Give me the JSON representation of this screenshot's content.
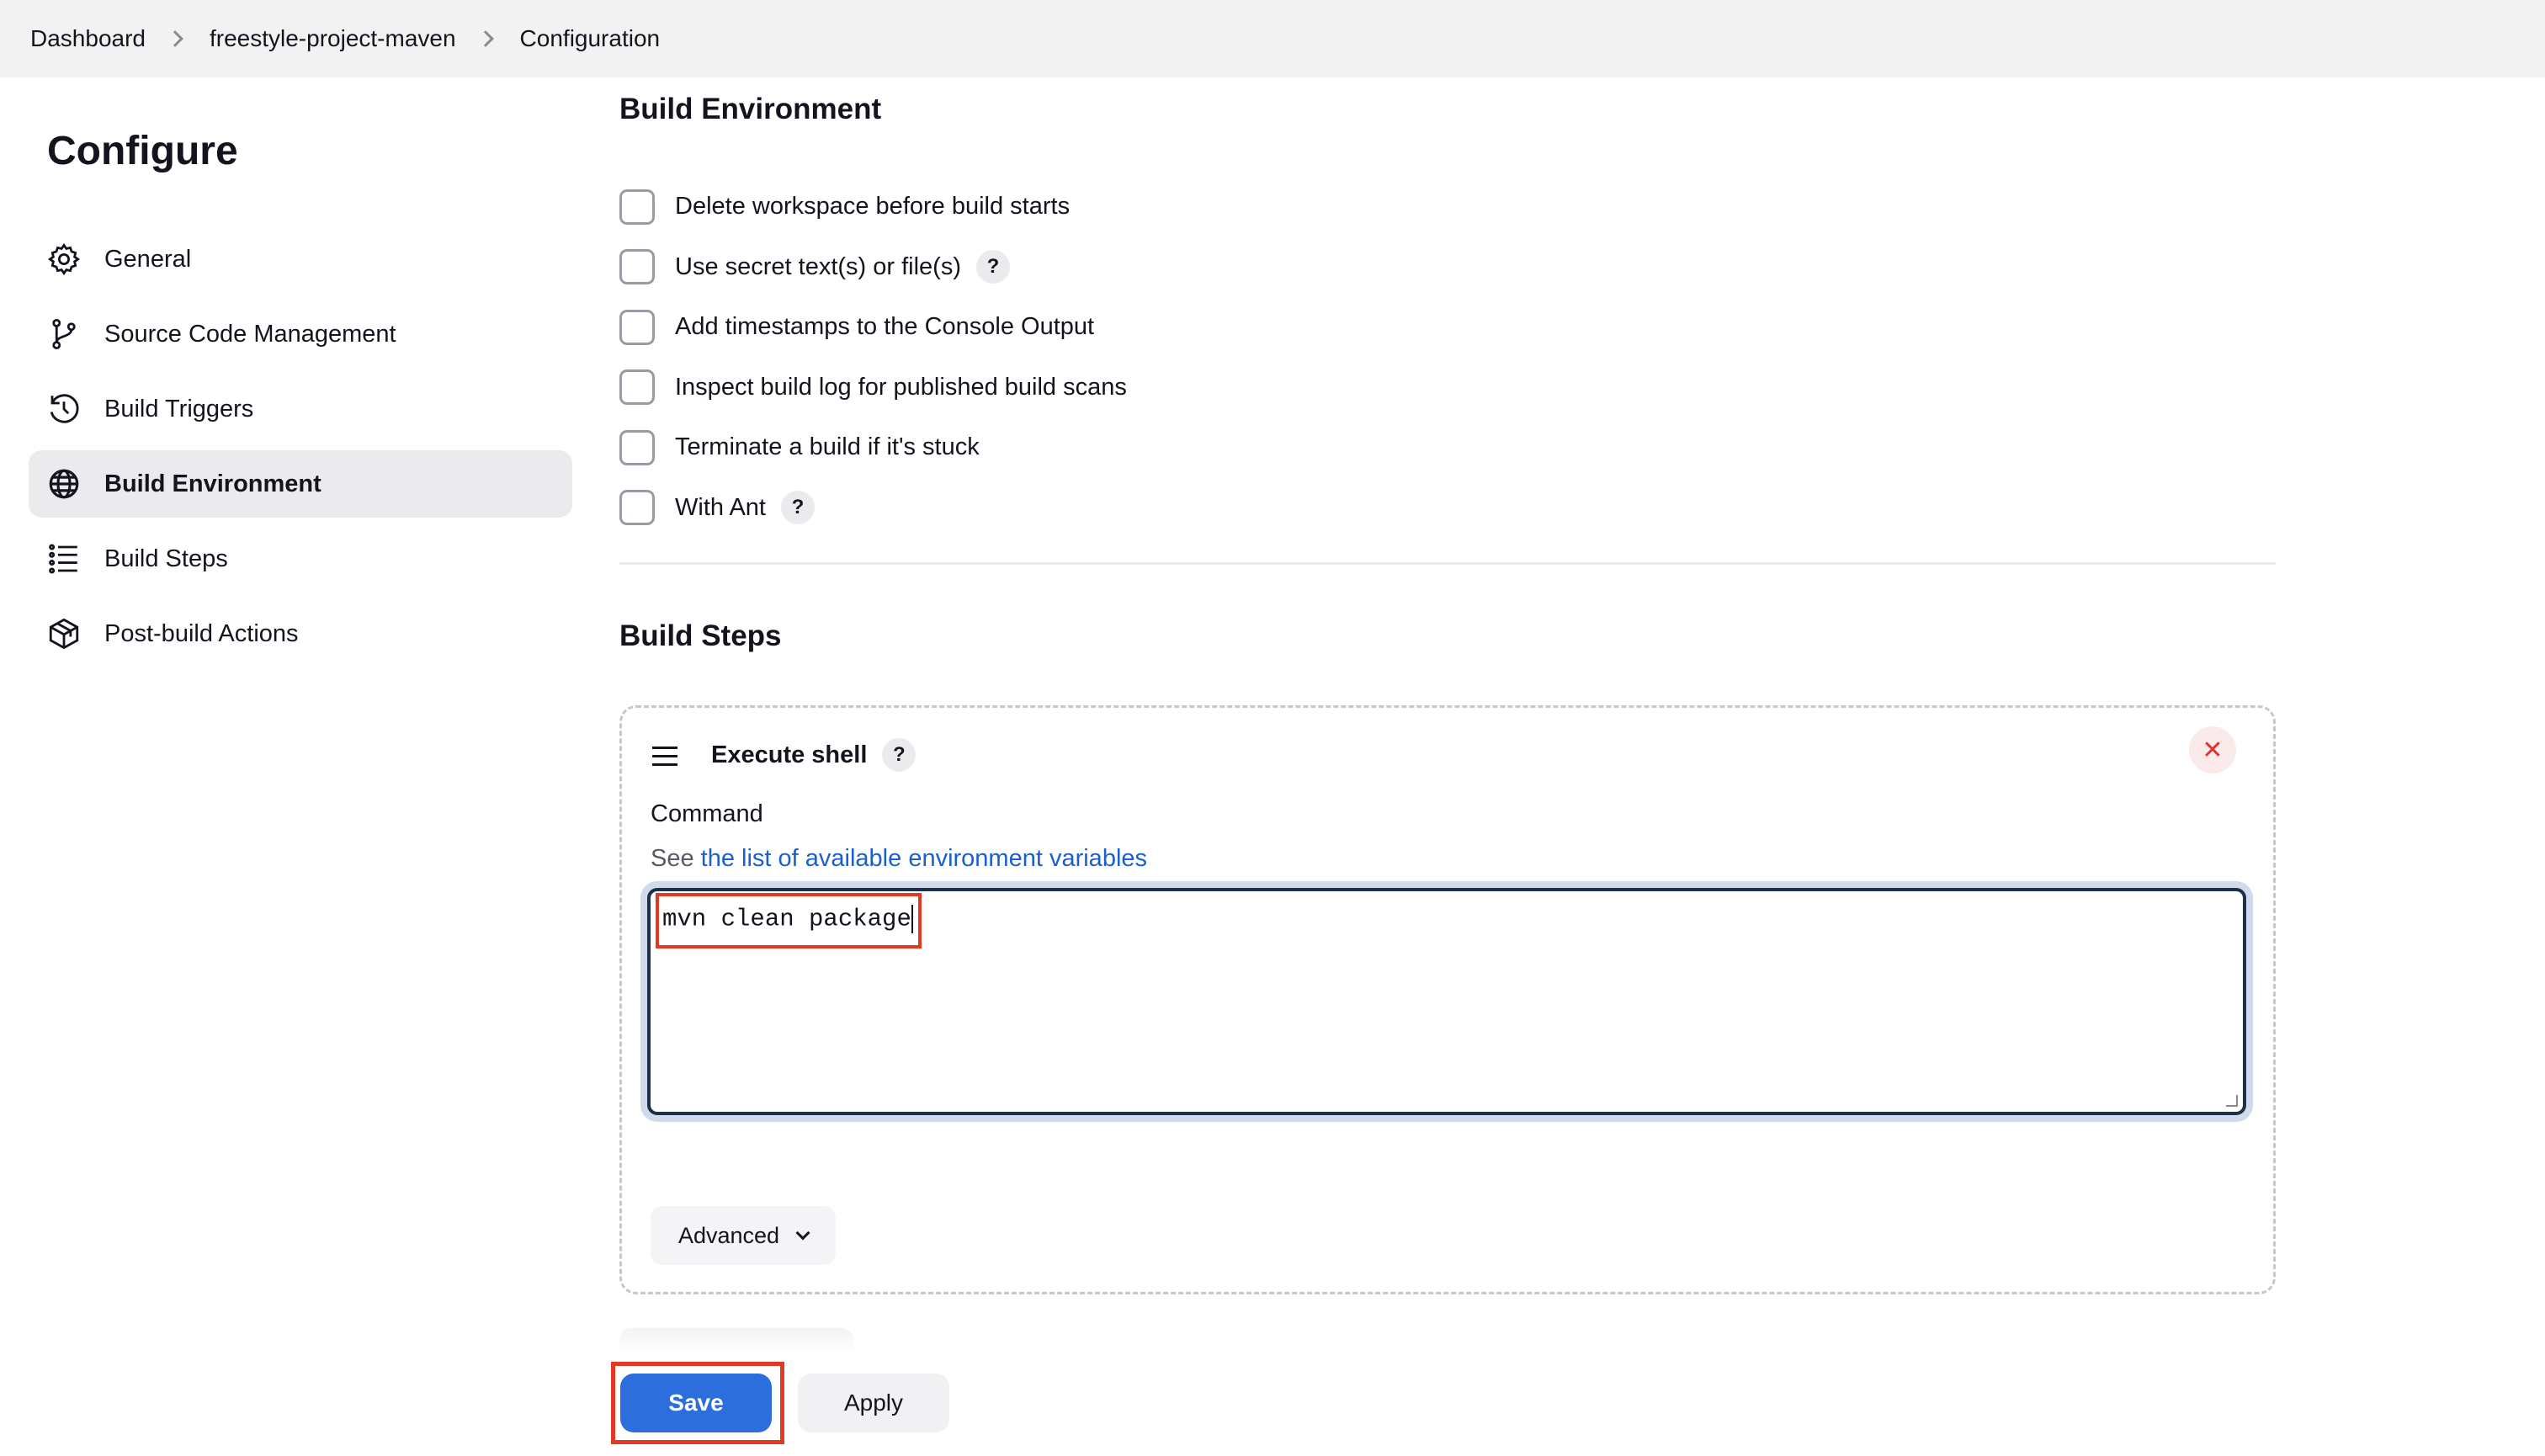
{
  "breadcrumb": [
    "Dashboard",
    "freestyle-project-maven",
    "Configuration"
  ],
  "sidebar": {
    "title": "Configure",
    "items": [
      {
        "label": "General",
        "icon": "gear-icon",
        "active": false
      },
      {
        "label": "Source Code Management",
        "icon": "branch-icon",
        "active": false
      },
      {
        "label": "Build Triggers",
        "icon": "clock-icon",
        "active": false
      },
      {
        "label": "Build Environment",
        "icon": "globe-icon",
        "active": true
      },
      {
        "label": "Build Steps",
        "icon": "list-icon",
        "active": false
      },
      {
        "label": "Post-build Actions",
        "icon": "package-icon",
        "active": false
      }
    ]
  },
  "build_environment": {
    "title": "Build Environment",
    "options": [
      {
        "label": "Delete workspace before build starts",
        "checked": false,
        "help": false
      },
      {
        "label": "Use secret text(s) or file(s)",
        "checked": false,
        "help": true
      },
      {
        "label": "Add timestamps to the Console Output",
        "checked": false,
        "help": false
      },
      {
        "label": "Inspect build log for published build scans",
        "checked": false,
        "help": false
      },
      {
        "label": "Terminate a build if it's stuck",
        "checked": false,
        "help": false
      },
      {
        "label": "With Ant",
        "checked": false,
        "help": true
      }
    ]
  },
  "build_steps": {
    "title": "Build Steps",
    "step": {
      "title": "Execute shell",
      "help": "?",
      "close": "✕",
      "command_label": "Command",
      "hint_prefix": "See",
      "hint_link": "the list of available environment variables",
      "command_value": "mvn clean package",
      "advanced_label": "Advanced"
    }
  },
  "footer": {
    "save_label": "Save",
    "apply_label": "Apply"
  },
  "colors": {
    "accent": "#2c6fdc",
    "highlight": "#e03a24",
    "link": "#1a5fd0"
  }
}
